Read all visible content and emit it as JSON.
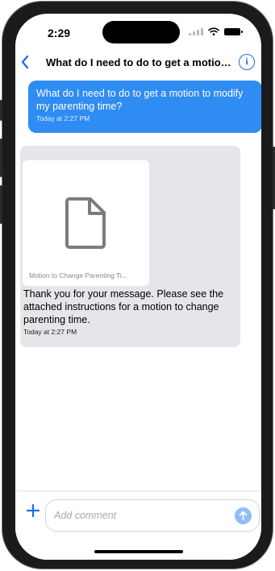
{
  "status_bar": {
    "time": "2:29",
    "icons": [
      "cellular-signal-icon",
      "wifi-icon",
      "battery-icon"
    ]
  },
  "nav": {
    "back_icon": "chevron-left-icon",
    "title": "What do I need to do to get a motion to modify my parenting time?",
    "info_icon": "info-circle-icon"
  },
  "messages": [
    {
      "direction": "outgoing",
      "text": "What do I need to do to get a motion to modify my parenting time?",
      "timestamp": "Today at 2:27 PM"
    },
    {
      "direction": "incoming",
      "attachment": {
        "name": "Motion to Change Parenting Ti...",
        "icon": "document-icon"
      },
      "text": "Thank you for your message. Please see the attached instructions for a motion to change parenting time.",
      "timestamp": "Today at 2:27 PM"
    }
  ],
  "composer": {
    "add_icon": "plus-icon",
    "placeholder": "Add comment",
    "value": "",
    "send_icon": "arrow-up-icon"
  },
  "colors": {
    "accent": "#1f6fe5",
    "outgoing_bubble": "#2f8cf2",
    "incoming_bubble": "#e6e6ea",
    "send_disabled": "#8fbef4"
  }
}
